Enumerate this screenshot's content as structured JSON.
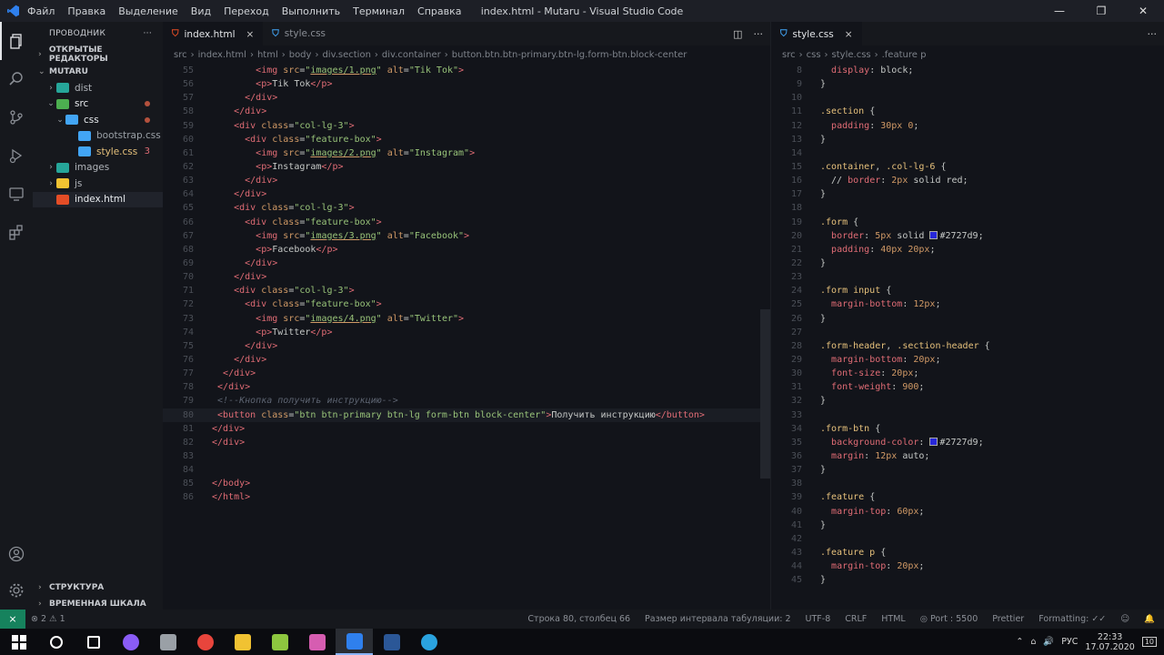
{
  "titlebar": {
    "menu": [
      "Файл",
      "Правка",
      "Выделение",
      "Вид",
      "Переход",
      "Выполнить",
      "Терминал",
      "Справка"
    ],
    "title": "index.html - Mutaru - Visual Studio Code"
  },
  "sidebar": {
    "header": "ПРОВОДНИК",
    "more": "···",
    "open_editors": "ОТКРЫТЫЕ РЕДАКТОРЫ",
    "project": "MUTARU",
    "tree": [
      {
        "label": "dist",
        "arrow": "›",
        "color": "#b0b4ba"
      },
      {
        "label": "src",
        "arrow": "⌄",
        "color": "#e8ebee"
      },
      {
        "label": "css",
        "arrow": "⌄",
        "color": "#e8ebee"
      },
      {
        "label": "bootstrap.css",
        "arrow": "",
        "color": "#9aa0a6"
      },
      {
        "label": "style.css",
        "arrow": "",
        "color": "#e5c07b",
        "count": "3"
      },
      {
        "label": "images",
        "arrow": "›",
        "color": "#b0b4ba"
      },
      {
        "label": "js",
        "arrow": "›",
        "color": "#b0b4ba"
      },
      {
        "label": "index.html",
        "arrow": "",
        "color": "#e8ebee"
      }
    ],
    "structure": "СТРУКТУРА",
    "timeline": "ВРЕМЕННАЯ ШКАЛА"
  },
  "editor1": {
    "tabs": [
      {
        "label": "index.html",
        "close": "×"
      },
      {
        "label": "style.css"
      }
    ],
    "breadcrumbs": [
      "src",
      "index.html",
      "html",
      "body",
      "div.section",
      "div.container",
      "button.btn.btn-primary.btn-lg.form-btn.block-center"
    ],
    "lines": [
      {
        "n": "55",
        "html": "        <span class='t'>&lt;img</span> <span class='a'>src</span>=<span class='s'>\"<span class='u'>images/1.png</span>\"</span> <span class='a'>alt</span>=<span class='s'>\"Tik Tok\"</span><span class='t'>&gt;</span>"
      },
      {
        "n": "56",
        "html": "        <span class='t'>&lt;p&gt;</span>Tik Tok<span class='t'>&lt;/p&gt;</span>"
      },
      {
        "n": "57",
        "html": "      <span class='t'>&lt;/div&gt;</span>"
      },
      {
        "n": "58",
        "html": "    <span class='t'>&lt;/div&gt;</span>"
      },
      {
        "n": "59",
        "html": "    <span class='t'>&lt;div</span> <span class='a'>class</span>=<span class='s'>\"col-lg-3\"</span><span class='t'>&gt;</span>"
      },
      {
        "n": "60",
        "html": "      <span class='t'>&lt;div</span> <span class='a'>class</span>=<span class='s'>\"feature-box\"</span><span class='t'>&gt;</span>"
      },
      {
        "n": "61",
        "html": "        <span class='t'>&lt;img</span> <span class='a'>src</span>=<span class='s'>\"<span class='u'>images/2.png</span>\"</span> <span class='a'>alt</span>=<span class='s'>\"Instagram\"</span><span class='t'>&gt;</span>"
      },
      {
        "n": "62",
        "html": "        <span class='t'>&lt;p&gt;</span>Instagram<span class='t'>&lt;/p&gt;</span>"
      },
      {
        "n": "63",
        "html": "      <span class='t'>&lt;/div&gt;</span>"
      },
      {
        "n": "64",
        "html": "    <span class='t'>&lt;/div&gt;</span>"
      },
      {
        "n": "65",
        "html": "    <span class='t'>&lt;div</span> <span class='a'>class</span>=<span class='s'>\"col-lg-3\"</span><span class='t'>&gt;</span>"
      },
      {
        "n": "66",
        "html": "      <span class='t'>&lt;div</span> <span class='a'>class</span>=<span class='s'>\"feature-box\"</span><span class='t'>&gt;</span>"
      },
      {
        "n": "67",
        "html": "        <span class='t'>&lt;img</span> <span class='a'>src</span>=<span class='s'>\"<span class='u'>images/3.png</span>\"</span> <span class='a'>alt</span>=<span class='s'>\"Facebook\"</span><span class='t'>&gt;</span>"
      },
      {
        "n": "68",
        "html": "        <span class='t'>&lt;p&gt;</span>Facebook<span class='t'>&lt;/p&gt;</span>"
      },
      {
        "n": "69",
        "html": "      <span class='t'>&lt;/div&gt;</span>"
      },
      {
        "n": "70",
        "html": "    <span class='t'>&lt;/div&gt;</span>"
      },
      {
        "n": "71",
        "html": "    <span class='t'>&lt;div</span> <span class='a'>class</span>=<span class='s'>\"col-lg-3\"</span><span class='t'>&gt;</span>"
      },
      {
        "n": "72",
        "html": "      <span class='t'>&lt;div</span> <span class='a'>class</span>=<span class='s'>\"feature-box\"</span><span class='t'>&gt;</span>"
      },
      {
        "n": "73",
        "html": "        <span class='t'>&lt;img</span> <span class='a'>src</span>=<span class='s'>\"<span class='u'>images/4.png</span>\"</span> <span class='a'>alt</span>=<span class='s'>\"Twitter\"</span><span class='t'>&gt;</span>"
      },
      {
        "n": "74",
        "html": "        <span class='t'>&lt;p&gt;</span>Twitter<span class='t'>&lt;/p&gt;</span>"
      },
      {
        "n": "75",
        "html": "      <span class='t'>&lt;/div&gt;</span>"
      },
      {
        "n": "76",
        "html": "    <span class='t'>&lt;/div&gt;</span>"
      },
      {
        "n": "77",
        "html": "  <span class='t'>&lt;/div&gt;</span>"
      },
      {
        "n": "78",
        "html": " <span class='t'>&lt;/div&gt;</span>"
      },
      {
        "n": "79",
        "html": " <span class='c'>&lt;!--Кнопка получить инструкцию--&gt;</span>"
      },
      {
        "n": "80",
        "html": " <span class='t'>&lt;button</span> <span class='a'>class</span>=<span class='s'>\"btn btn-primary btn-lg form-btn block-center\"</span><span class='t'>&gt;</span>Получить инструкцию<span class='t'>&lt;/button&gt;</span>",
        "current": true
      },
      {
        "n": "81",
        "html": "<span class='t'>&lt;/div&gt;</span>"
      },
      {
        "n": "82",
        "html": "<span class='t'>&lt;/div&gt;</span>"
      },
      {
        "n": "83",
        "html": ""
      },
      {
        "n": "84",
        "html": ""
      },
      {
        "n": "85",
        "html": "<span class='t'>&lt;/body&gt;</span>"
      },
      {
        "n": "86",
        "html": "<span class='t'>&lt;/html&gt;</span>"
      }
    ]
  },
  "editor2": {
    "tab": "style.css",
    "close": "×",
    "more": "···",
    "breadcrumbs": [
      "src",
      "css",
      "style.css",
      ".feature p"
    ],
    "lines": [
      {
        "n": "8",
        "html": "  <span class='prop'>display</span>: block;"
      },
      {
        "n": "9",
        "html": "<span class='brace'>}</span>"
      },
      {
        "n": "10",
        "html": ""
      },
      {
        "n": "11",
        "html": "<span class='sel-c'>.section</span> <span class='brace'>{</span>"
      },
      {
        "n": "12",
        "html": "  <span class='prop'>padding</span>: <span class='num'>30px</span> <span class='num'>0</span>;"
      },
      {
        "n": "13",
        "html": "<span class='brace'>}</span>"
      },
      {
        "n": "14",
        "html": ""
      },
      {
        "n": "15",
        "html": "<span class='sel-c'>.container</span>, <span class='sel-c'>.col-lg-6</span> <span class='brace'>{</span>"
      },
      {
        "n": "16",
        "html": "  // <span class='prop'>border</span>: <span class='num'>2px</span> solid red;"
      },
      {
        "n": "17",
        "html": "<span class='brace'>}</span>"
      },
      {
        "n": "18",
        "html": ""
      },
      {
        "n": "19",
        "html": "<span class='sel-c'>.form</span> <span class='brace'>{</span>"
      },
      {
        "n": "20",
        "html": "  <span class='prop'>border</span>: <span class='num'>5px</span> solid <span class='sw'></span>#2727d9;"
      },
      {
        "n": "21",
        "html": "  <span class='prop'>padding</span>: <span class='num'>40px</span> <span class='num'>20px</span>;"
      },
      {
        "n": "22",
        "html": "<span class='brace'>}</span>"
      },
      {
        "n": "23",
        "html": ""
      },
      {
        "n": "24",
        "html": "<span class='sel-c'>.form input</span> <span class='brace'>{</span>"
      },
      {
        "n": "25",
        "html": "  <span class='prop'>margin-bottom</span>: <span class='num'>12px</span>;"
      },
      {
        "n": "26",
        "html": "<span class='brace'>}</span>"
      },
      {
        "n": "27",
        "html": ""
      },
      {
        "n": "28",
        "html": "<span class='sel-c'>.form-header</span>, <span class='sel-c'>.section-header</span> <span class='brace'>{</span>"
      },
      {
        "n": "29",
        "html": "  <span class='prop'>margin-bottom</span>: <span class='num'>20px</span>;"
      },
      {
        "n": "30",
        "html": "  <span class='prop'>font-size</span>: <span class='num'>20px</span>;"
      },
      {
        "n": "31",
        "html": "  <span class='prop'>font-weight</span>: <span class='num'>900</span>;"
      },
      {
        "n": "32",
        "html": "<span class='brace'>}</span>"
      },
      {
        "n": "33",
        "html": ""
      },
      {
        "n": "34",
        "html": "<span class='sel-c'>.form-btn</span> <span class='brace'>{</span>"
      },
      {
        "n": "35",
        "html": "  <span class='prop'>background-color</span>: <span class='sw'></span>#2727d9;"
      },
      {
        "n": "36",
        "html": "  <span class='prop'>margin</span>: <span class='num'>12px</span> auto;"
      },
      {
        "n": "37",
        "html": "<span class='brace'>}</span>"
      },
      {
        "n": "38",
        "html": ""
      },
      {
        "n": "39",
        "html": "<span class='sel-c'>.feature</span> <span class='brace'>{</span>"
      },
      {
        "n": "40",
        "html": "  <span class='prop'>margin-top</span>: <span class='num'>60px</span>;"
      },
      {
        "n": "41",
        "html": "<span class='brace'>}</span>"
      },
      {
        "n": "42",
        "html": ""
      },
      {
        "n": "43",
        "html": "<span class='sel-c'>.feature p</span> <span class='brace'>{</span>"
      },
      {
        "n": "44",
        "html": "  <span class='prop'>margin-top</span>: <span class='num'>20px</span>;"
      },
      {
        "n": "45",
        "html": "<span class='brace'>}</span>"
      }
    ]
  },
  "statusbar": {
    "problems": "⊗ 2 ⚠ 1",
    "items": [
      "Строка 80, столбец 66",
      "Размер интервала табуляции: 2",
      "UTF-8",
      "CRLF",
      "HTML",
      "◎ Port : 5500",
      "Prettier",
      "Formatting: ✓✓",
      "☺",
      "🔔"
    ]
  },
  "taskbar": {
    "lang": "РУС",
    "time": "22:33",
    "date": "17.07.2020",
    "notif": "10",
    "apps": [
      {
        "name": "search-icon",
        "color": "#ffffff"
      },
      {
        "name": "task-view-icon",
        "color": "#ffffff"
      },
      {
        "name": "alice-icon",
        "color": "#8a5cf6"
      },
      {
        "name": "photos-icon",
        "color": "#9aa0a6"
      },
      {
        "name": "chrome-icon",
        "color": "#e8453c"
      },
      {
        "name": "explorer-icon",
        "color": "#f1c232"
      },
      {
        "name": "xlsx-icon",
        "color": "#8dc63f"
      },
      {
        "name": "paint-icon",
        "color": "#d65db1"
      },
      {
        "name": "vscode-icon",
        "color": "#2f80ed"
      },
      {
        "name": "word-icon",
        "color": "#2b5797"
      },
      {
        "name": "telegram-icon",
        "color": "#2aa3df"
      }
    ]
  }
}
